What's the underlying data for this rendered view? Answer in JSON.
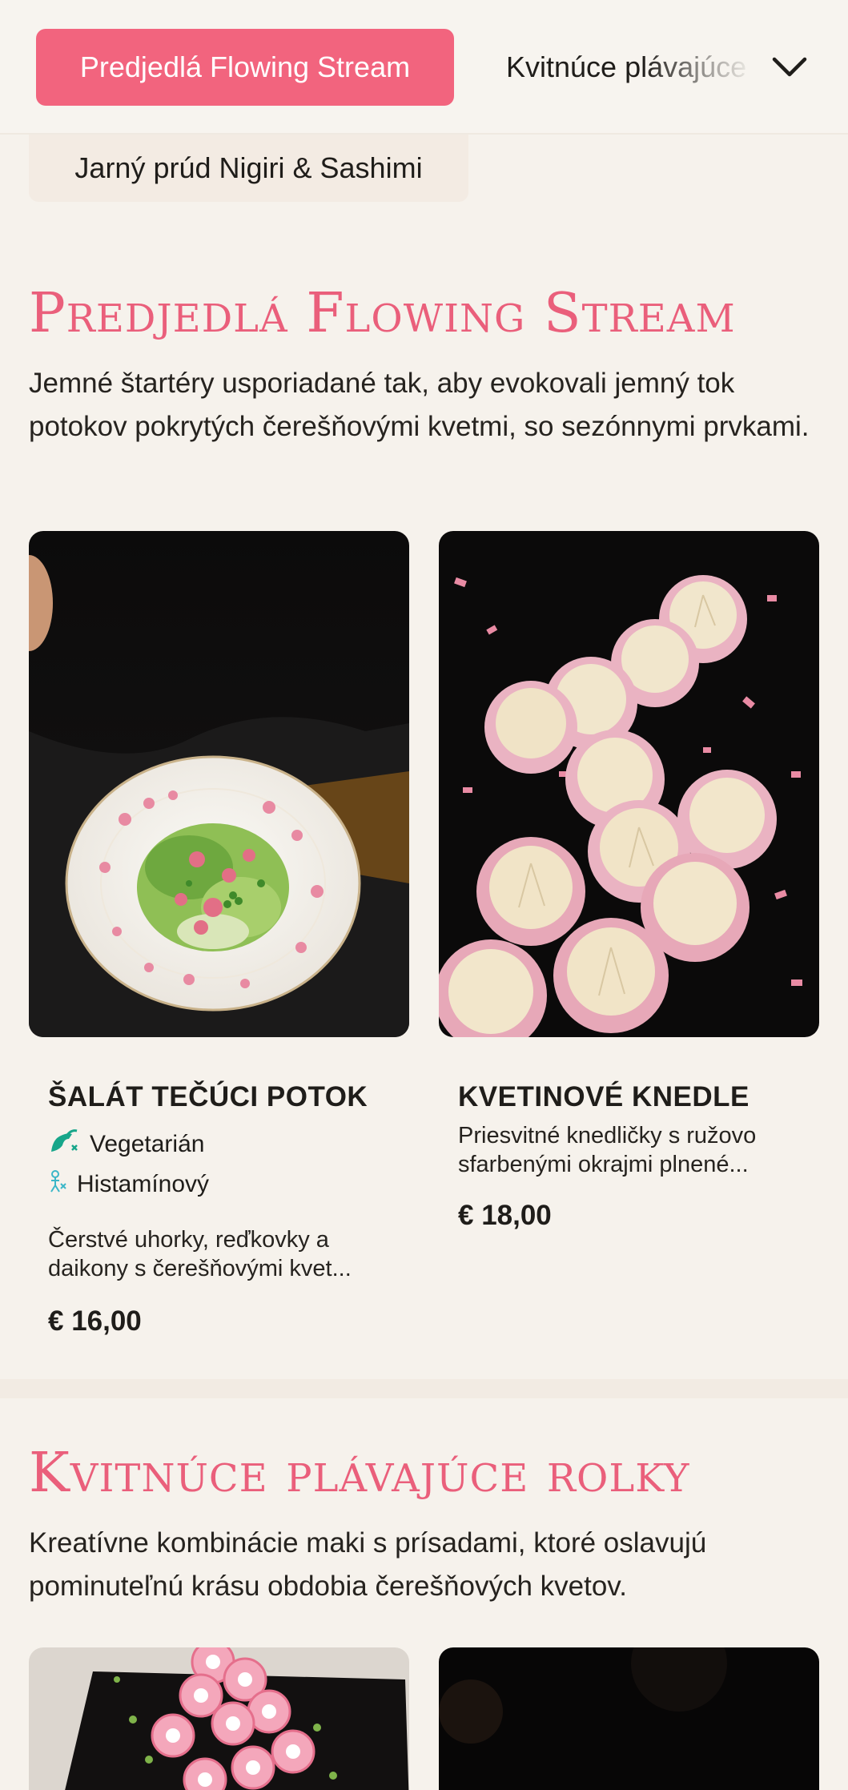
{
  "nav": {
    "active_label": "Predjedlá Flowing Stream",
    "next_label": "Kvitnúce plávajúce rolky",
    "secondary_label": "Jarný prúd Nigiri & Sashimi"
  },
  "sections": [
    {
      "title": "Predjedlá Flowing Stream",
      "description": "Jemné štartéry usporiadané tak, aby evokovali jemný tok potokov pokrytých čerešňovými kvetmi, so sezónnymi prvkami.",
      "items": [
        {
          "name": "ŠALÁT TEČÚCI POTOK",
          "tags": [
            "Vegetarián",
            "Histamínový"
          ],
          "description": "Čerstvé uhorky, reďkovky a daikony s čerešňovými kvet...",
          "price": "€ 16,00"
        },
        {
          "name": "KVETINOVÉ KNEDLE",
          "tags": [],
          "description": "Priesvitné knedličky s ružovo sfarbenými okrajmi plnené...",
          "price": "€ 18,00"
        }
      ]
    },
    {
      "title": "Kvitnúce plávajúce rolky",
      "description": "Kreatívne kombinácie maki s prísadami, ktoré oslavujú pominuteľnú krásu obdobia čerešňových kvetov."
    }
  ],
  "colors": {
    "accent": "#f2647e",
    "title": "#ea5f7b",
    "background": "#f6f2ec",
    "tag_icon": "#17a68a"
  }
}
